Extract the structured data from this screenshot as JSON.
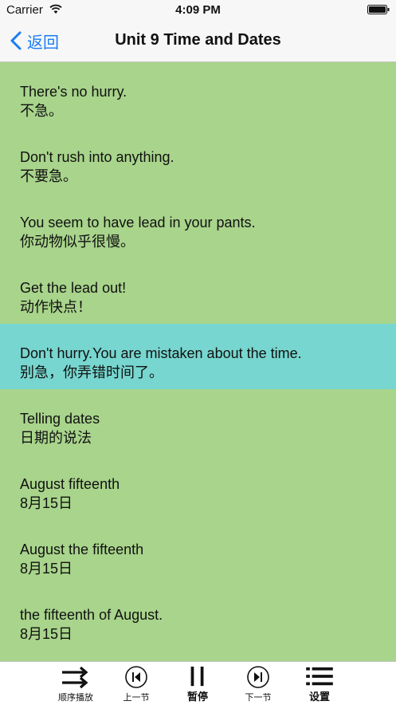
{
  "status_bar": {
    "carrier": "Carrier",
    "time": "4:09 PM"
  },
  "nav": {
    "back_label": "返回",
    "title": "Unit 9 Time and Dates"
  },
  "colors": {
    "background": "#a8d48b",
    "highlight": "#77d6cf",
    "accent": "#1a7cf4"
  },
  "phrases": [
    {
      "en": "There's no hurry.",
      "zh": "不急。"
    },
    {
      "en": "Don't rush into anything.",
      "zh": "不要急。"
    },
    {
      "en": "You seem to have lead in your pants.",
      "zh": "你动物似乎很慢。"
    },
    {
      "en": "Get the lead out!",
      "zh": "动作快点！"
    },
    {
      "en": "Don't hurry.You are mistaken about the time.",
      "zh": "别急，你弄错时间了。"
    },
    {
      "en": "Telling dates",
      "zh": "日期的说法"
    },
    {
      "en": "August fifteenth",
      "zh": "8月15日"
    },
    {
      "en": "August the fifteenth",
      "zh": "8月15日"
    },
    {
      "en": "the fifteenth of August.",
      "zh": "8月15日"
    }
  ],
  "tabs": {
    "order": {
      "label": "顺序播放",
      "icon": "shuffle-arrows-icon"
    },
    "prev": {
      "label": "上一节",
      "icon": "previous-track-icon"
    },
    "pause": {
      "label": "暂停",
      "icon": "pause-icon"
    },
    "next": {
      "label": "下一节",
      "icon": "next-track-icon"
    },
    "settings": {
      "label": "设置",
      "icon": "list-menu-icon"
    }
  }
}
